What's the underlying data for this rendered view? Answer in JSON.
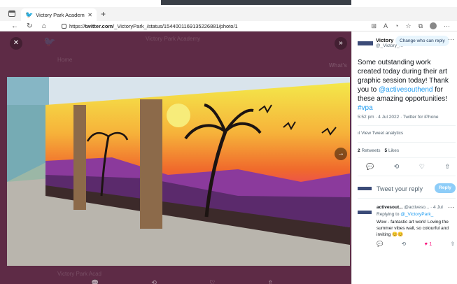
{
  "browser": {
    "tab_title": "Victory Park Academy (@_Vict",
    "url_prefix": "https://",
    "url_domain": "twitter.com",
    "url_path": "/_VictoryPark_/status/1544001169135226881/photo/1"
  },
  "tweet": {
    "author_name": "Victory",
    "author_handle": "@_Victory_...",
    "who_can_reply": "Change who can reply",
    "text_before": "Some outstanding work created today during their art graphic session today! Thank you to ",
    "mention": "@activesouthend",
    "text_after": " for these amazing opportunities! ",
    "hashtag": "#vpa",
    "meta": "5:52 pm · 4 Jul 2022 · Twitter for iPhone",
    "analytics": "View Tweet analytics",
    "retweets_count": "2",
    "retweets_label": "Retweets",
    "likes_count": "5",
    "likes_label": "Likes"
  },
  "compose": {
    "prompt": "Tweet your reply",
    "button": "Reply"
  },
  "reply": {
    "name": "activesout...",
    "handle_date": "@activeso... · 4 Jul",
    "replying_to": "Replying to",
    "replying_handle": "@_VictoryPark_",
    "text": "Wow - fantastic art work! Loving the summer vibes wall, so colourful and inviting 😊😊",
    "likes": "1"
  },
  "background": {
    "nav_home": "Home",
    "header_title": "Victory Park Academy",
    "side_heading": "What's",
    "footer_name": "Victory Park Acad"
  },
  "icons": {
    "close": "close-icon",
    "collapse": "chevrons-right-icon",
    "next": "arrow-right-icon",
    "analytics": "bar-chart-icon",
    "reply": "reply-icon",
    "retweet": "retweet-icon",
    "like": "heart-icon",
    "share": "share-icon",
    "more": "more-icon"
  },
  "colors": {
    "viewer_bg": "#5e2b46",
    "accent": "#1d9bf0",
    "reply_button": "#8ecdf8",
    "like_active": "#f91880"
  }
}
